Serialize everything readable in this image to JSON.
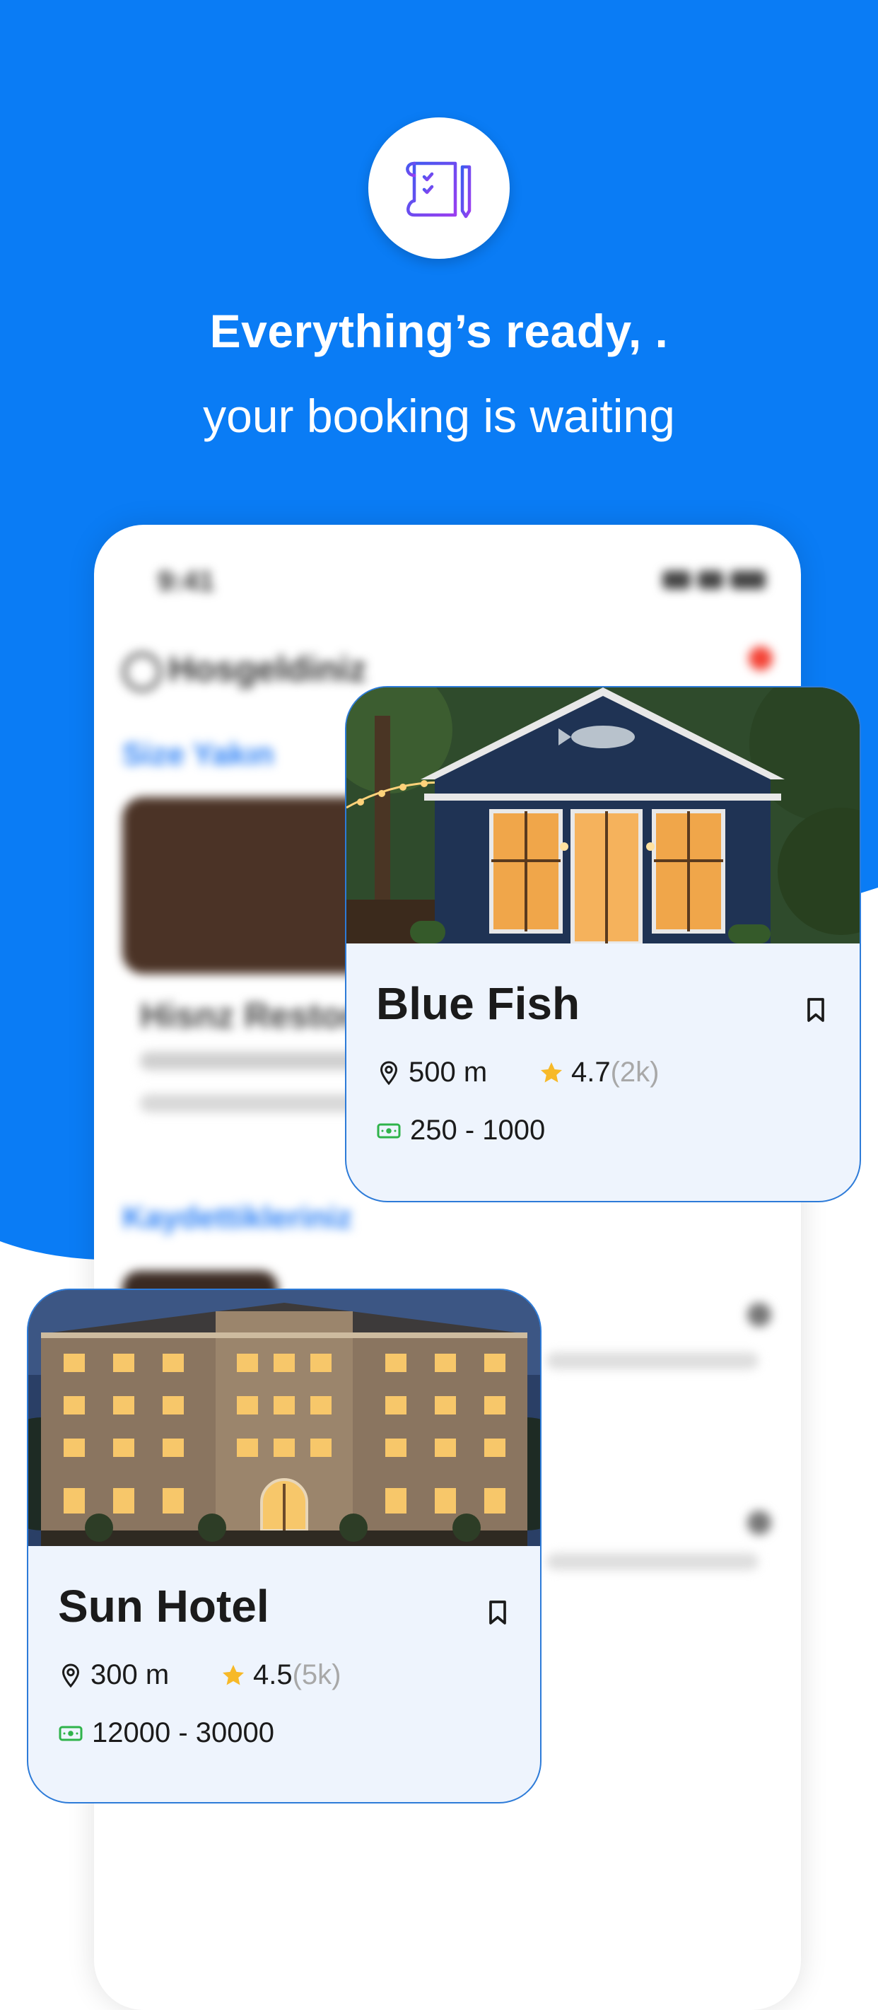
{
  "headline": "Everything’s ready,  .",
  "subline": "your booking is waiting",
  "phone": {
    "time": "9:41",
    "welcome": "Hosgeldiniz",
    "section_nearby": "Size Yakın",
    "card_name": "Hisnz Restora",
    "section_favorites": "Kaydettikleriniz"
  },
  "cards": [
    {
      "name": "Blue Fish",
      "distance": "500 m",
      "rating": "4.7",
      "reviews": "(2k)",
      "price": "250 - 1000"
    },
    {
      "name": "Sun Hotel",
      "distance": "300 m",
      "rating": "4.5",
      "reviews": "(5k)",
      "price": "12000 - 30000"
    }
  ],
  "colors": {
    "brand_blue": "#0a7cf5",
    "star": "#f7b928",
    "money": "#2fb34a",
    "card_border": "#2d7bd8"
  },
  "icons": [
    "document-list-icon",
    "location-pin-icon",
    "star-icon",
    "money-icon",
    "bookmark-icon"
  ]
}
